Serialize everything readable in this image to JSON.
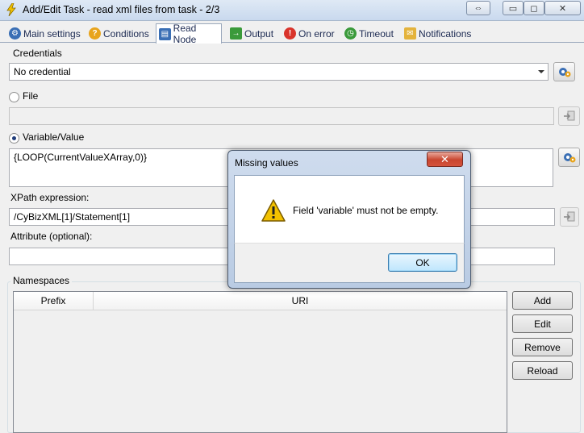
{
  "window": {
    "title": "Add/Edit Task - read xml files from task - 2/3",
    "move_glyph": "⇔",
    "minimize_glyph": "▭",
    "maximize_glyph": "◻",
    "close_glyph": "✕"
  },
  "tabs": [
    {
      "label": "Main settings",
      "icon": "gears-icon",
      "color": "#3a6fb5",
      "active": false
    },
    {
      "label": "Conditions",
      "icon": "help-icon",
      "color": "#e8a41c",
      "active": false
    },
    {
      "label": "Read Node",
      "icon": "xml-node-icon",
      "color": "#3a6fb5",
      "active": true
    },
    {
      "label": "Output",
      "icon": "output-icon",
      "color": "#3a9a3a",
      "active": false
    },
    {
      "label": "On error",
      "icon": "error-icon",
      "color": "#d9342b",
      "active": false
    },
    {
      "label": "Timeout",
      "icon": "clock-icon",
      "color": "#3a9a3a",
      "active": false
    },
    {
      "label": "Notifications",
      "icon": "envelope-icon",
      "color": "#e4b33c",
      "active": false
    }
  ],
  "credentials": {
    "label": "Credentials",
    "value": "No credential"
  },
  "file": {
    "label": "File",
    "value": "",
    "checked": false
  },
  "variable": {
    "label": "Variable/Value",
    "value": "{LOOP(CurrentValueXArray,0)}",
    "checked": true
  },
  "xpath": {
    "label": "XPath expression:",
    "value": "/CyBizXML[1]/Statement[1]"
  },
  "attribute": {
    "label": "Attribute (optional):",
    "value": ""
  },
  "namespaces": {
    "label": "Namespaces",
    "columns": [
      "Prefix",
      "URI"
    ],
    "rows": [],
    "buttons": {
      "add": "Add",
      "edit": "Edit",
      "remove": "Remove",
      "reload": "Reload"
    }
  },
  "dialog": {
    "title": "Missing values",
    "message": "Field 'variable' must not be empty.",
    "ok_label": "OK",
    "close_glyph": "✕",
    "icon": "warning-icon"
  },
  "colors": {
    "accent": "#3a6fb5",
    "warning": "#f2c100",
    "close_red": "#c8452f"
  }
}
